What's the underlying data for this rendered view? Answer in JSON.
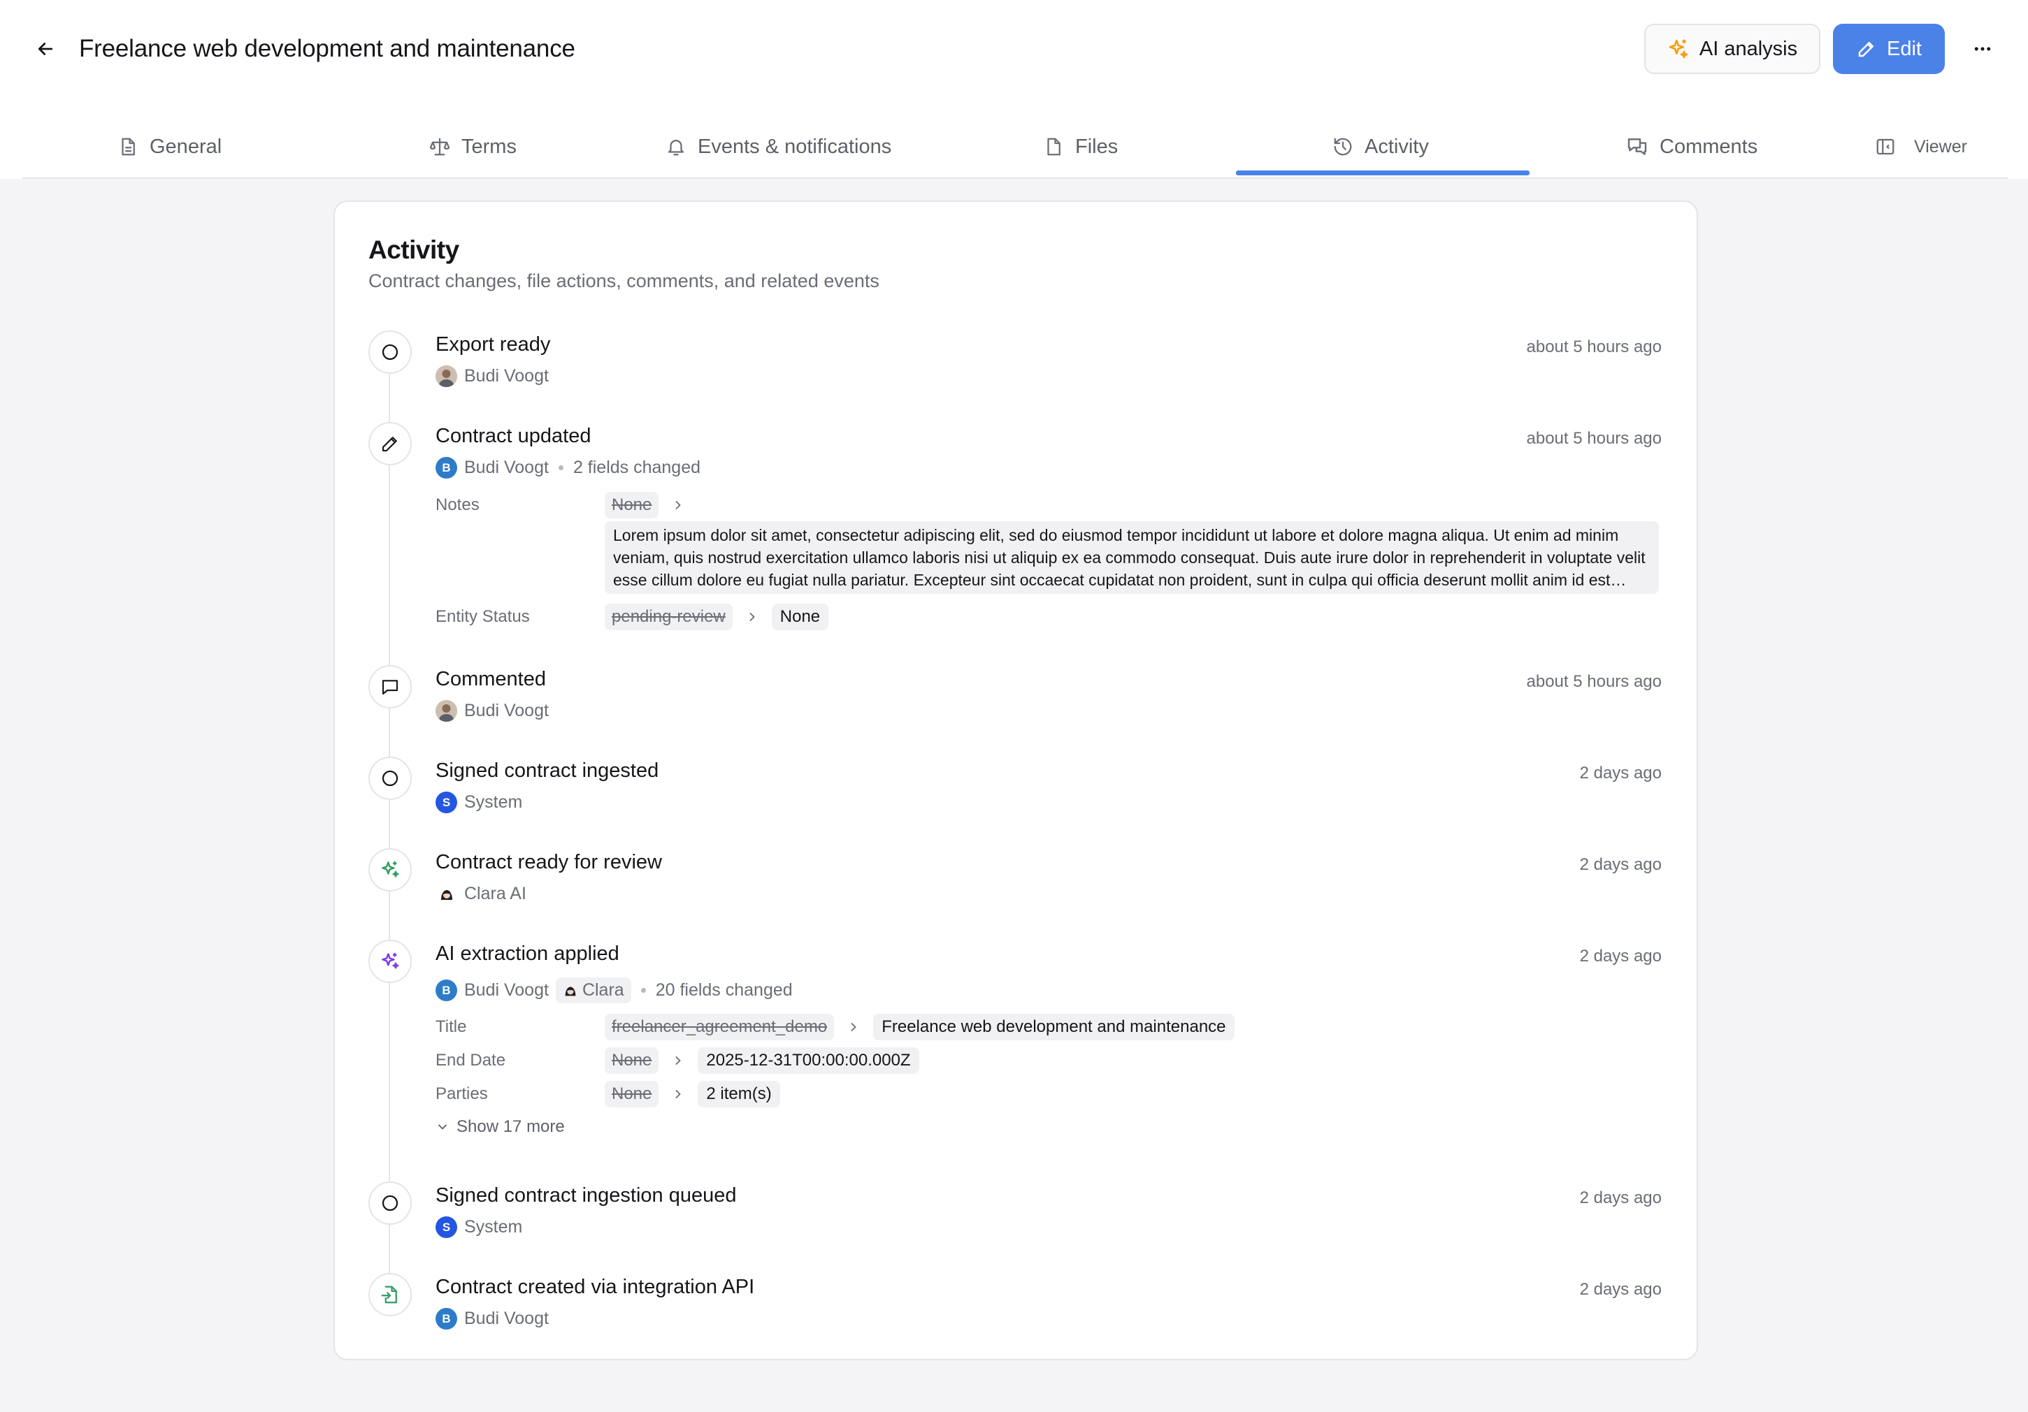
{
  "header": {
    "title": "Freelance web development and maintenance",
    "ai_button": "AI analysis",
    "edit_button": "Edit"
  },
  "tabs": [
    {
      "label": "General"
    },
    {
      "label": "Terms"
    },
    {
      "label": "Events & notifications"
    },
    {
      "label": "Files"
    },
    {
      "label": "Activity"
    },
    {
      "label": "Comments"
    },
    {
      "label": "Viewer"
    }
  ],
  "active_tab": "Activity",
  "colors": {
    "accent": "#4b82e8",
    "ai_icon": "#f59e0b",
    "ai_purple": "#7c3aed",
    "green": "#2f9e62"
  },
  "activity": {
    "title": "Activity",
    "subtitle": "Contract changes, file actions, comments, and related events",
    "events": [
      {
        "title": "Export ready",
        "time": "about 5 hours ago",
        "user": "Budi Voogt",
        "icon": "circle-icon"
      },
      {
        "title": "Contract updated",
        "time": "about 5 hours ago",
        "user": "Budi Voogt",
        "avatar_letter": "B",
        "changes": "2 fields changed",
        "icon": "pencil-icon",
        "fields": [
          {
            "label": "Notes",
            "old": "None",
            "new": "Lorem ipsum dolor sit amet, consectetur adipiscing elit, sed do eiusmod tempor incididunt ut labore et dolore magna aliqua. Ut enim ad minim veniam, quis nostrud exercitation ullamco laboris nisi ut aliquip ex ea commodo consequat. Duis aute irure dolor in reprehenderit in voluptate velit esse cillum dolore eu fugiat nulla pariatur. Excepteur sint occaecat cupidatat non proident, sunt in culpa qui officia deserunt mollit anim id est laborum."
          },
          {
            "label": "Entity Status",
            "old": "pending-review",
            "new": "None"
          }
        ]
      },
      {
        "title": "Commented",
        "time": "about 5 hours ago",
        "user": "Budi Voogt",
        "icon": "comment-icon"
      },
      {
        "title": "Signed contract ingested",
        "time": "2 days ago",
        "user": "System",
        "avatar_letter": "S",
        "icon": "circle-icon"
      },
      {
        "title": "Contract ready for review",
        "time": "2 days ago",
        "user": "Clara AI",
        "icon": "sparkle-green-icon"
      },
      {
        "title": "AI extraction applied",
        "time": "2 days ago",
        "user": "Budi Voogt",
        "avatar_letter": "B",
        "agent": "Clara",
        "changes": "20 fields changed",
        "icon": "sparkle-purple-icon",
        "fields": [
          {
            "label": "Title",
            "old": "freelancer_agreement_demo",
            "new": "Freelance web development and maintenance"
          },
          {
            "label": "End Date",
            "old": "None",
            "new": "2025-12-31T00:00:00.000Z"
          },
          {
            "label": "Parties",
            "old": "None",
            "new": "2 item(s)"
          }
        ],
        "show_more": "Show 17 more"
      },
      {
        "title": "Signed contract ingestion queued",
        "time": "2 days ago",
        "user": "System",
        "avatar_letter": "S",
        "icon": "circle-icon"
      },
      {
        "title": "Contract created via integration API",
        "time": "2 days ago",
        "user": "Budi Voogt",
        "avatar_letter": "B",
        "icon": "file-import-icon"
      }
    ]
  }
}
